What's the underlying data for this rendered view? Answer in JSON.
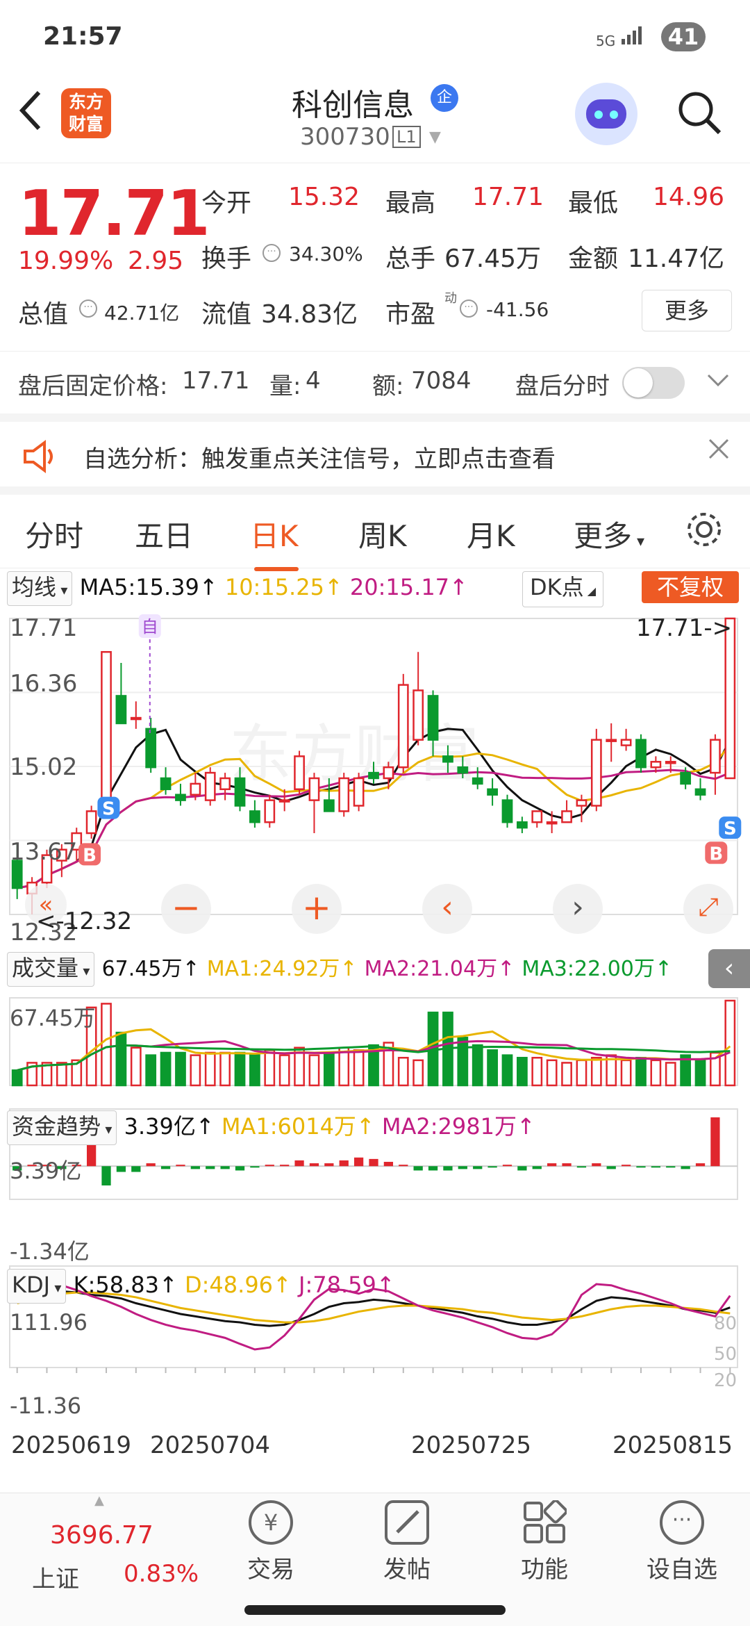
{
  "status": {
    "time": "21:57",
    "signal": "5G",
    "battery": "41"
  },
  "header": {
    "back": "<",
    "logo_line1": "东方",
    "logo_line2": "财富",
    "name": "科创信息",
    "badge": "企",
    "code": "300730",
    "level": "L1"
  },
  "quote": {
    "price": "17.71",
    "pct": "19.99%",
    "change": "2.95",
    "open_label": "今开",
    "open": "15.32",
    "high_label": "最高",
    "high": "17.71",
    "low_label": "最低",
    "low": "14.96",
    "turnover_label": "换手",
    "turnover": "34.30%",
    "volume_label": "总手",
    "volume": "67.45万",
    "amount_label": "金额",
    "amount": "11.47亿",
    "mcap_label": "总值",
    "mcap": "42.71亿",
    "float_label": "流值",
    "float": "34.83亿",
    "pe_label": "市盈",
    "pe_sup": "动",
    "pe": "-41.56",
    "more": "更多"
  },
  "after_hours": {
    "price_label": "盘后固定价格:",
    "price": "17.71",
    "vol_label": "量:",
    "vol": "4",
    "amt_label": "额:",
    "amt": "7084",
    "switch_label": "盘后分时"
  },
  "notice": {
    "text": "自选分析：触发重点关注信号，立即点击查看"
  },
  "tabs": [
    "分时",
    "五日",
    "日K",
    "周K",
    "月K",
    "更多"
  ],
  "indicators": {
    "ma_sel": "均线",
    "ma5": "MA5:15.39↑",
    "ma10": "10:15.25↑",
    "ma20": "20:15.17↑",
    "dk": "DK点",
    "fq": "不复权",
    "vol_sel": "成交量",
    "vol_now": "67.45万↑",
    "vol_ma1": "MA1:24.92万↑",
    "vol_ma2": "MA2:21.04万↑",
    "vol_ma3": "MA3:22.00万↑",
    "fund_sel": "资金趋势",
    "fund_now": "3.39亿↑",
    "fund_ma1": "MA1:6014万↑",
    "fund_ma2": "MA2:2981万↑",
    "kdj_sel": "KDJ",
    "k": "K:58.83↑",
    "d": "D:48.96↑",
    "j": "J:78.59↑"
  },
  "chart_data": {
    "type": "candlestick",
    "price_axis": [
      "17.71",
      "16.36",
      "15.02",
      "13.67",
      "12.32"
    ],
    "max_label": "17.71->",
    "min_label": "<-12.32",
    "vol_axis_max": "67.45万",
    "fund_axis": [
      "3.39亿",
      "-1.34亿"
    ],
    "kdj_axis": [
      "111.96",
      "-11.36"
    ],
    "kdj_right_axis": [
      "80",
      "50",
      "20"
    ],
    "dates": [
      "20250619",
      "20250704",
      "20250725",
      "20250815"
    ],
    "markers": {
      "self": "自",
      "buy": "B",
      "sell": "S"
    },
    "candles": [
      {
        "o": 13.3,
        "h": 13.6,
        "l": 12.6,
        "c": 12.8
      },
      {
        "o": 12.7,
        "h": 13.0,
        "l": 12.32,
        "c": 12.9
      },
      {
        "o": 12.9,
        "h": 13.5,
        "l": 12.8,
        "c": 13.4
      },
      {
        "o": 13.3,
        "h": 13.6,
        "l": 13.0,
        "c": 13.5
      },
      {
        "o": 13.5,
        "h": 13.9,
        "l": 13.3,
        "c": 13.8
      },
      {
        "o": 13.8,
        "h": 14.3,
        "l": 13.7,
        "c": 14.2
      },
      {
        "o": 14.2,
        "h": 17.1,
        "l": 14.1,
        "c": 17.1
      },
      {
        "o": 16.3,
        "h": 16.9,
        "l": 15.9,
        "c": 15.8
      },
      {
        "o": 15.9,
        "h": 16.2,
        "l": 15.7,
        "c": 15.9
      },
      {
        "o": 15.7,
        "h": 15.9,
        "l": 14.9,
        "c": 15.0
      },
      {
        "o": 14.8,
        "h": 15.0,
        "l": 14.5,
        "c": 14.6
      },
      {
        "o": 14.5,
        "h": 14.7,
        "l": 14.3,
        "c": 14.4
      },
      {
        "o": 14.5,
        "h": 14.9,
        "l": 14.4,
        "c": 14.7
      },
      {
        "o": 14.4,
        "h": 15.0,
        "l": 14.3,
        "c": 14.9
      },
      {
        "o": 14.6,
        "h": 14.9,
        "l": 14.4,
        "c": 14.8
      },
      {
        "o": 14.8,
        "h": 15.0,
        "l": 14.2,
        "c": 14.3
      },
      {
        "o": 14.2,
        "h": 14.4,
        "l": 13.9,
        "c": 14.0
      },
      {
        "o": 14.0,
        "h": 14.5,
        "l": 13.9,
        "c": 14.4
      },
      {
        "o": 14.4,
        "h": 14.6,
        "l": 14.2,
        "c": 14.4
      },
      {
        "o": 14.6,
        "h": 15.3,
        "l": 14.5,
        "c": 15.2
      },
      {
        "o": 14.4,
        "h": 14.9,
        "l": 13.8,
        "c": 14.8
      },
      {
        "o": 14.4,
        "h": 14.8,
        "l": 14.2,
        "c": 14.2
      },
      {
        "o": 14.2,
        "h": 14.9,
        "l": 14.1,
        "c": 14.8
      },
      {
        "o": 14.3,
        "h": 14.9,
        "l": 14.2,
        "c": 14.8
      },
      {
        "o": 14.9,
        "h": 15.1,
        "l": 14.7,
        "c": 14.8
      },
      {
        "o": 14.8,
        "h": 15.1,
        "l": 14.6,
        "c": 15.0
      },
      {
        "o": 15.0,
        "h": 16.7,
        "l": 14.9,
        "c": 16.5
      },
      {
        "o": 15.5,
        "h": 17.1,
        "l": 15.4,
        "c": 16.4
      },
      {
        "o": 16.3,
        "h": 16.4,
        "l": 15.2,
        "c": 15.5
      },
      {
        "o": 15.2,
        "h": 15.4,
        "l": 14.9,
        "c": 15.1
      },
      {
        "o": 15.0,
        "h": 15.2,
        "l": 14.8,
        "c": 14.9
      },
      {
        "o": 14.8,
        "h": 15.0,
        "l": 14.6,
        "c": 14.7
      },
      {
        "o": 14.6,
        "h": 14.8,
        "l": 14.3,
        "c": 14.5
      },
      {
        "o": 14.4,
        "h": 14.5,
        "l": 13.9,
        "c": 14.0
      },
      {
        "o": 14.0,
        "h": 14.1,
        "l": 13.8,
        "c": 13.9
      },
      {
        "o": 14.0,
        "h": 14.2,
        "l": 13.9,
        "c": 14.2
      },
      {
        "o": 14.0,
        "h": 14.2,
        "l": 13.8,
        "c": 14.0
      },
      {
        "o": 14.0,
        "h": 14.4,
        "l": 14.0,
        "c": 14.2
      },
      {
        "o": 14.3,
        "h": 14.5,
        "l": 14.0,
        "c": 14.4
      },
      {
        "o": 14.3,
        "h": 15.7,
        "l": 14.2,
        "c": 15.5
      },
      {
        "o": 15.5,
        "h": 15.8,
        "l": 15.1,
        "c": 15.5
      },
      {
        "o": 15.4,
        "h": 15.7,
        "l": 15.3,
        "c": 15.5
      },
      {
        "o": 15.5,
        "h": 15.6,
        "l": 14.9,
        "c": 15.0
      },
      {
        "o": 15.0,
        "h": 15.2,
        "l": 14.9,
        "c": 15.1
      },
      {
        "o": 15.1,
        "h": 15.2,
        "l": 14.9,
        "c": 15.1
      },
      {
        "o": 14.9,
        "h": 15.0,
        "l": 14.6,
        "c": 14.7
      },
      {
        "o": 14.6,
        "h": 14.8,
        "l": 14.4,
        "c": 14.5
      },
      {
        "o": 14.9,
        "h": 15.6,
        "l": 14.5,
        "c": 15.5
      },
      {
        "o": 14.8,
        "h": 17.71,
        "l": 14.96,
        "c": 17.71
      }
    ],
    "volumes": [
      12,
      18,
      18,
      18,
      20,
      62,
      65,
      42,
      30,
      24,
      26,
      26,
      24,
      26,
      26,
      26,
      24,
      28,
      24,
      30,
      24,
      26,
      30,
      28,
      32,
      34,
      22,
      20,
      58,
      58,
      38,
      32,
      28,
      24,
      22,
      22,
      20,
      18,
      20,
      22,
      24,
      20,
      22,
      20,
      18,
      24,
      20,
      26,
      67.45
    ],
    "funds": [
      -0.3,
      0.1,
      0.1,
      -0.2,
      0.1,
      1.6,
      -1.34,
      -0.4,
      -0.4,
      0.2,
      -0.2,
      0.1,
      -0.2,
      -0.2,
      -0.2,
      -0.3,
      -0.1,
      0.1,
      0.1,
      0.4,
      0.2,
      0.2,
      0.4,
      0.6,
      0.5,
      0.3,
      0.1,
      -0.3,
      -0.3,
      -0.3,
      -0.2,
      -0.2,
      -0.1,
      0.1,
      -0.3,
      -0.2,
      0.2,
      0.2,
      -0.1,
      0.2,
      -0.2,
      0.1,
      -0.1,
      -0.1,
      -0.1,
      -0.2,
      0.2,
      3.39
    ],
    "kdj_k": [
      70,
      82,
      88,
      86,
      84,
      80,
      78,
      74,
      66,
      60,
      54,
      48,
      44,
      40,
      36,
      34,
      30,
      28,
      30,
      38,
      48,
      60,
      66,
      68,
      72,
      70,
      66,
      62,
      58,
      54,
      50,
      44,
      40,
      34,
      30,
      30,
      34,
      40,
      56,
      70,
      76,
      74,
      70,
      66,
      62,
      56,
      54,
      50,
      58.83
    ],
    "kdj_d": [
      66,
      72,
      78,
      82,
      84,
      84,
      82,
      80,
      76,
      70,
      64,
      58,
      54,
      50,
      46,
      42,
      38,
      36,
      34,
      34,
      36,
      40,
      46,
      52,
      56,
      60,
      62,
      62,
      60,
      58,
      56,
      52,
      50,
      46,
      42,
      40,
      38,
      40,
      44,
      50,
      56,
      60,
      62,
      62,
      60,
      58,
      56,
      52,
      48.96
    ],
    "kdj_j": [
      78,
      96,
      111.96,
      96,
      88,
      78,
      70,
      60,
      48,
      38,
      30,
      24,
      20,
      14,
      8,
      -2,
      -11.36,
      -8,
      12,
      40,
      72,
      90,
      88,
      82,
      90,
      86,
      74,
      62,
      54,
      48,
      42,
      34,
      26,
      16,
      8,
      6,
      14,
      36,
      80,
      98,
      96,
      88,
      82,
      74,
      66,
      56,
      50,
      44,
      78.59
    ]
  },
  "bottom_nav": {
    "index_value": "3696.77",
    "index_name": "上证",
    "index_pct": "0.83%",
    "trade": "交易",
    "post": "发帖",
    "func": "功能",
    "watch": "设自选"
  },
  "colors": {
    "up": "#e0262d",
    "down": "#0a9a2e",
    "accent": "#ee5a24",
    "ma5": "#111111",
    "ma10": "#e8b400",
    "ma20": "#c01c82"
  }
}
